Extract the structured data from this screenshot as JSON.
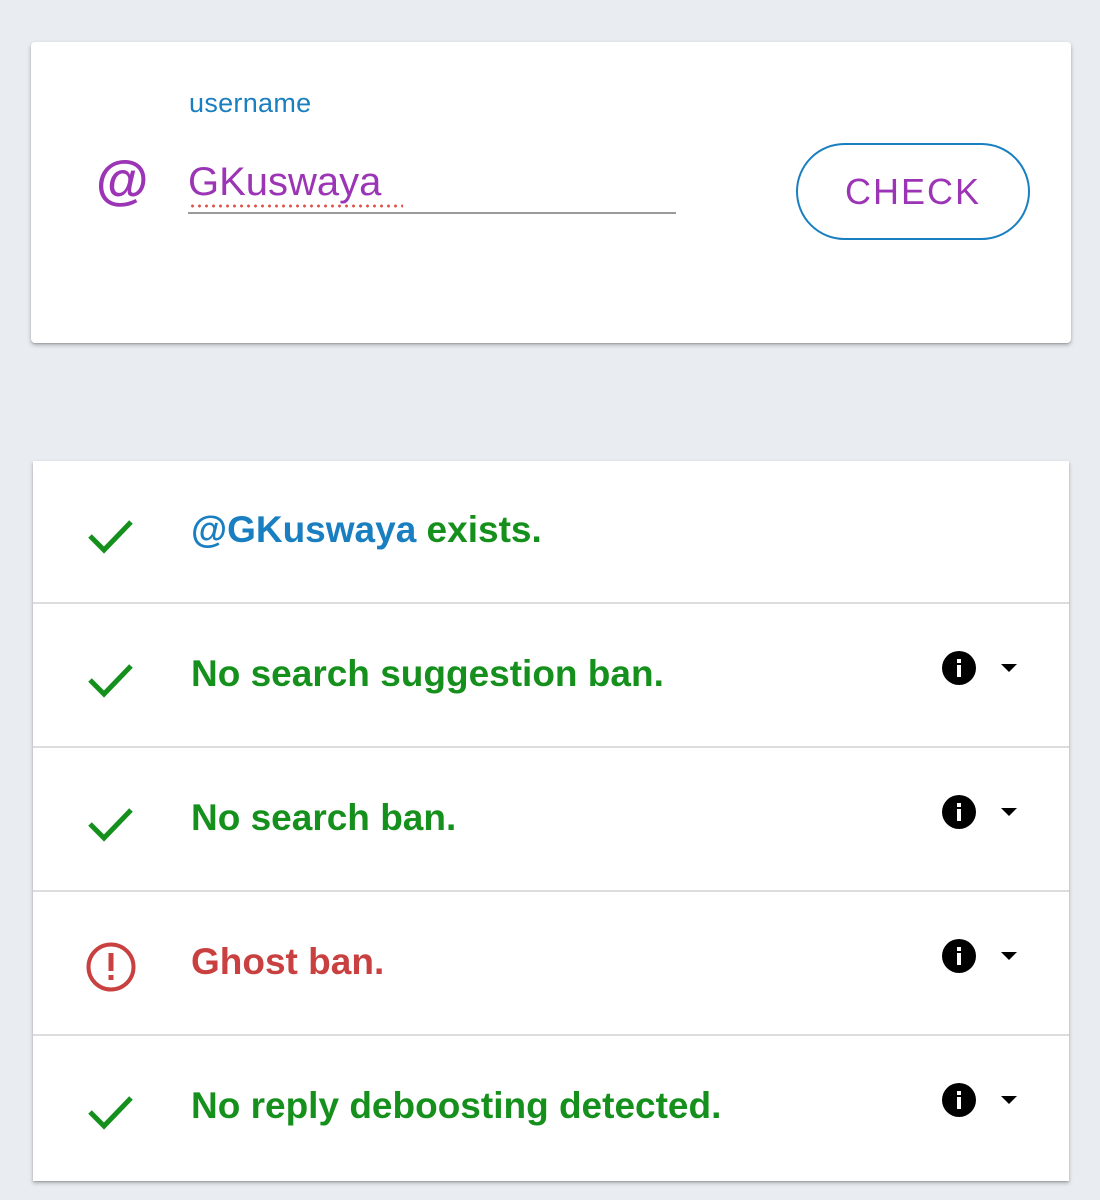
{
  "search": {
    "label": "username",
    "at_symbol": "@",
    "value": "GKuswaya",
    "button_label": "CHECK",
    "at_icon": "at-sign-icon"
  },
  "results": [
    {
      "status": "ok",
      "handle": "@GKuswaya",
      "text": " exists.",
      "has_info": false
    },
    {
      "status": "ok",
      "text": "No search suggestion ban.",
      "has_info": true
    },
    {
      "status": "ok",
      "text": "No search ban.",
      "has_info": true
    },
    {
      "status": "warning",
      "text": "Ghost ban.",
      "has_info": true
    },
    {
      "status": "ok",
      "text": "No reply deboosting detected.",
      "has_info": true
    }
  ],
  "icons": {
    "ok": "checkmark-icon",
    "warning": "alert-circle-icon",
    "info": "info-icon",
    "expand": "dropdown-arrow-icon"
  },
  "colors": {
    "background": "#e9edf1",
    "accent_blue": "#1a7fc0",
    "accent_purple": "#9c35b5",
    "ok_green": "#16901c",
    "warning_red": "#c94040"
  }
}
